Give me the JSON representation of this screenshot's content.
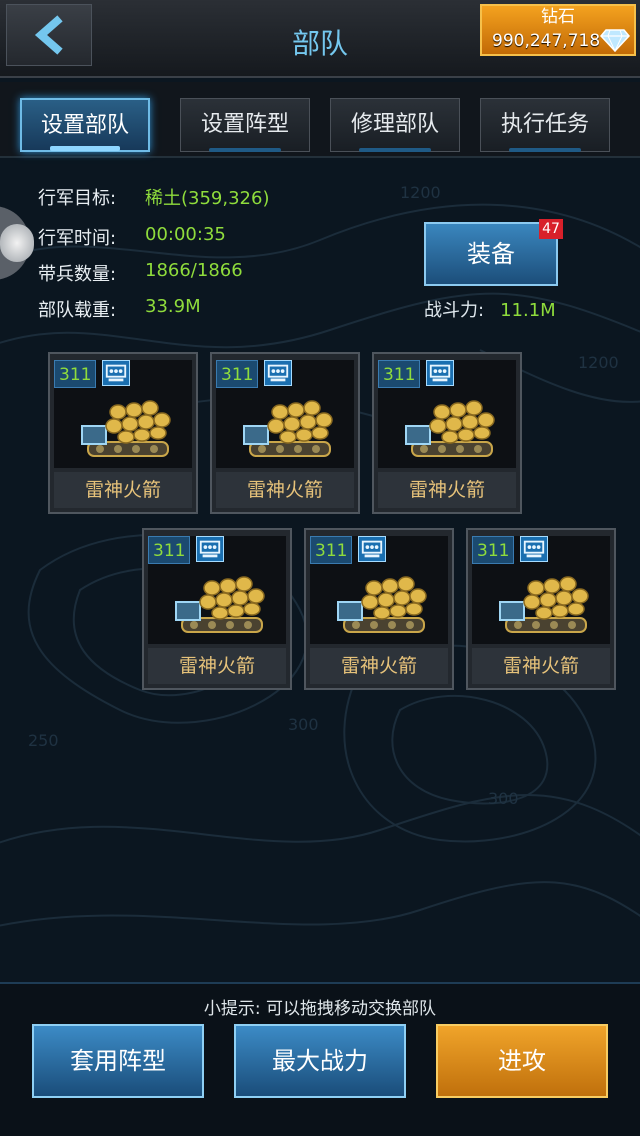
{
  "header": {
    "title": "部队",
    "diamond_label": "钻石",
    "diamond_value": "990,247,718"
  },
  "tabs": [
    {
      "label": "设置部队",
      "active": true
    },
    {
      "label": "设置阵型",
      "active": false
    },
    {
      "label": "修理部队",
      "active": false
    },
    {
      "label": "执行任务",
      "active": false
    }
  ],
  "info": {
    "target_label": "行军目标:",
    "target_value": "稀土(359,326)",
    "time_label": "行军时间:",
    "time_value": "00:00:35",
    "troops_label": "带兵数量:",
    "troops_value": "1866/1866",
    "load_label": "部队载重:",
    "load_value": "33.9M",
    "power_label": "战斗力:",
    "power_value": "11.1M"
  },
  "equip": {
    "label": "装备",
    "badge": "47"
  },
  "units": [
    {
      "level": "311",
      "name": "雷神火箭"
    },
    {
      "level": "311",
      "name": "雷神火箭"
    },
    {
      "level": "311",
      "name": "雷神火箭"
    },
    {
      "level": "311",
      "name": "雷神火箭"
    },
    {
      "level": "311",
      "name": "雷神火箭"
    },
    {
      "level": "311",
      "name": "雷神火箭"
    }
  ],
  "map_labels": [
    "1200",
    "1200",
    "300",
    "250",
    "300"
  ],
  "bottom": {
    "tip": "小提示: 可以拖拽移动交换部队",
    "apply_formation": "套用阵型",
    "max_power": "最大战力",
    "attack": "进攻"
  },
  "colors": {
    "accent_blue": "#74c7ee",
    "value_green": "#8fdc3c",
    "diamond_orange": "#f4a21f",
    "unit_name_gold": "#e6c27a"
  }
}
